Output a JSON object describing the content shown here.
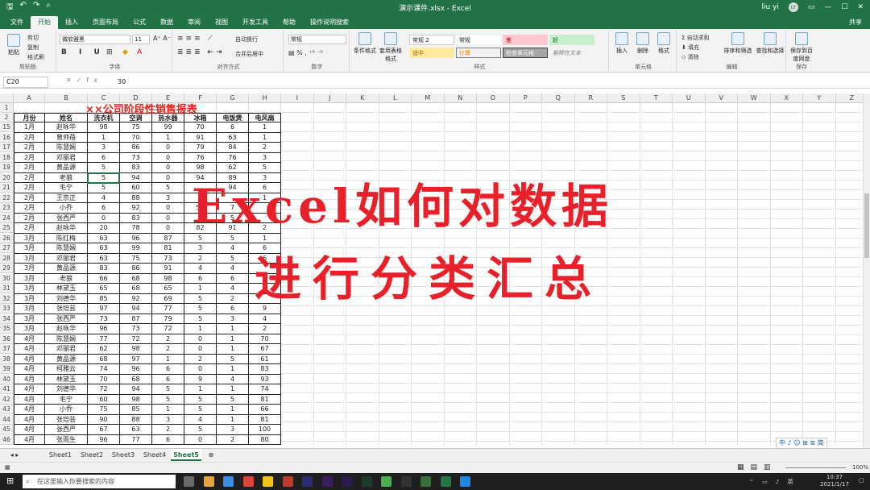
{
  "window": {
    "title": "演示课件.xlsx  -  Excel",
    "user": "liu yi",
    "user_initials": "LY"
  },
  "tabs": [
    "文件",
    "开始",
    "插入",
    "页面布局",
    "公式",
    "数据",
    "审阅",
    "视图",
    "开发工具",
    "帮助",
    "操作说明搜索"
  ],
  "active_tab": "开始",
  "share_label": "共享",
  "ribbon": {
    "clipboard": {
      "label": "剪贴板",
      "paste": "粘贴",
      "cut": "剪切",
      "copy": "复制",
      "format_painter": "格式刷"
    },
    "font": {
      "label": "字体",
      "name": "微软雅黑",
      "size": "11"
    },
    "alignment": {
      "label": "对齐方式",
      "wrap": "自动换行",
      "merge": "合并后居中"
    },
    "number": {
      "label": "数字",
      "format": "常规"
    },
    "styles": {
      "label": "样式",
      "conditional": "条件格式",
      "table": "套用表格格式",
      "cells": [
        "常规 2",
        "常规",
        "差",
        "好",
        "适中",
        "计算",
        "检查单元格",
        "解释性文本"
      ]
    },
    "cells": {
      "label": "单元格",
      "insert": "插入",
      "delete": "删除",
      "format": "格式"
    },
    "editing": {
      "label": "编辑",
      "autosum": "自动求和",
      "fill": "填充",
      "clear": "清除",
      "sort": "排序和筛选",
      "find": "查找和选择"
    },
    "save": {
      "label": "保存",
      "baidu": "保存到百度网盘"
    }
  },
  "formula_bar": {
    "name_box": "C20",
    "value": "30",
    "fx": "fx"
  },
  "columns": [
    "A",
    "B",
    "C",
    "D",
    "E",
    "F",
    "G",
    "H",
    "I",
    "J",
    "K",
    "L",
    "M",
    "N",
    "O",
    "P",
    "Q",
    "R",
    "S",
    "T",
    "U",
    "V",
    "W",
    "X",
    "Y",
    "Z"
  ],
  "sheet": {
    "title": "××公司阶段性销售报表",
    "headers": [
      "月份",
      "姓名",
      "洗衣机",
      "空调",
      "热水器",
      "冰箱",
      "电饭煲",
      "电风扇"
    ],
    "rows": [
      {
        "n": "15",
        "c": [
          "1月",
          "赵咏华",
          "98",
          "75",
          "99",
          "70",
          "6",
          "1"
        ]
      },
      {
        "n": "16",
        "c": [
          "2月",
          "曾帅蓓",
          "1",
          "70",
          "1",
          "91",
          "63",
          "1"
        ]
      },
      {
        "n": "17",
        "c": [
          "2月",
          "陈慧娴",
          "3",
          "86",
          "0",
          "79",
          "84",
          "2"
        ]
      },
      {
        "n": "18",
        "c": [
          "2月",
          "邓丽君",
          "6",
          "73",
          "0",
          "76",
          "76",
          "3"
        ]
      },
      {
        "n": "19",
        "c": [
          "2月",
          "黄品源",
          "5",
          "83",
          "0",
          "98",
          "62",
          "5"
        ]
      },
      {
        "n": "20",
        "c": [
          "2月",
          "老狼",
          "5",
          "94",
          "0",
          "94",
          "89",
          "3"
        ]
      },
      {
        "n": "21",
        "c": [
          "2月",
          "毛宁",
          "5",
          "60",
          "5",
          "",
          "94",
          "6"
        ]
      },
      {
        "n": "22",
        "c": [
          "2月",
          "王京正",
          "4",
          "88",
          "3",
          "",
          "",
          "1"
        ]
      },
      {
        "n": "23",
        "c": [
          "2月",
          "小乔",
          "6",
          "92",
          "0",
          "56",
          "7",
          ""
        ]
      },
      {
        "n": "24",
        "c": [
          "2月",
          "张西严",
          "0",
          "83",
          "0",
          "5",
          "5",
          ""
        ]
      },
      {
        "n": "25",
        "c": [
          "2月",
          "赵咏华",
          "20",
          "78",
          "0",
          "82",
          "91",
          "2"
        ]
      },
      {
        "n": "26",
        "c": [
          "3月",
          "陈红梅",
          "63",
          "96",
          "87",
          "5",
          "5",
          "1"
        ]
      },
      {
        "n": "27",
        "c": [
          "3月",
          "陈慧娴",
          "63",
          "99",
          "81",
          "3",
          "4",
          "6"
        ]
      },
      {
        "n": "28",
        "c": [
          "3月",
          "邓丽君",
          "63",
          "75",
          "73",
          "2",
          "5",
          "6"
        ]
      },
      {
        "n": "29",
        "c": [
          "3月",
          "黄品源",
          "83",
          "86",
          "91",
          "4",
          "4",
          ""
        ]
      },
      {
        "n": "30",
        "c": [
          "3月",
          "老狼",
          "66",
          "68",
          "98",
          "6",
          "6",
          ""
        ]
      },
      {
        "n": "31",
        "c": [
          "3月",
          "林黛玉",
          "65",
          "68",
          "65",
          "1",
          "4",
          ""
        ]
      },
      {
        "n": "32",
        "c": [
          "3月",
          "刘德华",
          "85",
          "92",
          "69",
          "5",
          "2",
          ""
        ]
      },
      {
        "n": "33",
        "c": [
          "3月",
          "张培芸",
          "97",
          "94",
          "77",
          "5",
          "6",
          "9"
        ]
      },
      {
        "n": "34",
        "c": [
          "3月",
          "张西严",
          "73",
          "87",
          "79",
          "5",
          "3",
          "4"
        ]
      },
      {
        "n": "35",
        "c": [
          "3月",
          "赵咏华",
          "96",
          "73",
          "72",
          "1",
          "1",
          "2"
        ]
      },
      {
        "n": "36",
        "c": [
          "4月",
          "陈慧娴",
          "77",
          "72",
          "2",
          "0",
          "1",
          "70"
        ]
      },
      {
        "n": "37",
        "c": [
          "4月",
          "邓丽君",
          "62",
          "98",
          "2",
          "0",
          "1",
          "67"
        ]
      },
      {
        "n": "38",
        "c": [
          "4月",
          "黄品源",
          "68",
          "97",
          "1",
          "2",
          "5",
          "61"
        ]
      },
      {
        "n": "39",
        "c": [
          "4月",
          "柯雅云",
          "74",
          "96",
          "6",
          "0",
          "1",
          "83"
        ]
      },
      {
        "n": "40",
        "c": [
          "4月",
          "林黛玉",
          "70",
          "68",
          "6",
          "9",
          "4",
          "93"
        ]
      },
      {
        "n": "41",
        "c": [
          "4月",
          "刘德华",
          "72",
          "94",
          "5",
          "1",
          "1",
          "74"
        ]
      },
      {
        "n": "42",
        "c": [
          "4月",
          "毛宁",
          "60",
          "98",
          "5",
          "5",
          "5",
          "81"
        ]
      },
      {
        "n": "43",
        "c": [
          "4月",
          "小乔",
          "75",
          "85",
          "1",
          "5",
          "1",
          "66"
        ]
      },
      {
        "n": "44",
        "c": [
          "4月",
          "张培芸",
          "90",
          "88",
          "3",
          "4",
          "1",
          "81"
        ]
      },
      {
        "n": "45",
        "c": [
          "4月",
          "张西严",
          "67",
          "63",
          "2",
          "5",
          "3",
          "100"
        ]
      },
      {
        "n": "46",
        "c": [
          "4月",
          "张雨生",
          "96",
          "77",
          "6",
          "0",
          "2",
          "80"
        ]
      }
    ]
  },
  "overlay": {
    "line1": "Excel如何对数据",
    "line2": "进行分类汇总"
  },
  "sheet_tabs": [
    "Sheet1",
    "Sheet2",
    "Sheet3",
    "Sheet4",
    "Sheet5"
  ],
  "active_sheet": "Sheet5",
  "status": {
    "zoom": "100%"
  },
  "taskbar": {
    "search_placeholder": "在这里输入你要搜索的内容",
    "time": "10:37",
    "date": "2021/1/17"
  },
  "ime": "中 ♪ ☺ ⊞ ≣ 简"
}
